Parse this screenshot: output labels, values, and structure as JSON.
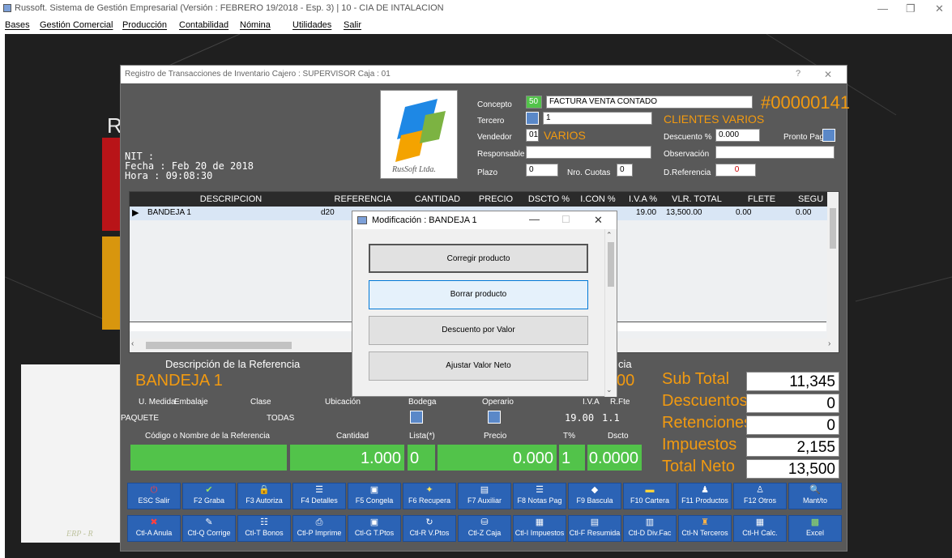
{
  "app": {
    "title": "Russoft. Sistema de Gestión Empresarial (Versión : FEBRERO 19/2018 - Esp. 3) | 10 - CIA DE INTALACION",
    "menu": [
      "Bases",
      "Gestión Comercial",
      "Producción",
      "Contabilidad",
      "Nómina",
      "Utilidades",
      "Salir"
    ],
    "bg_letter": "R",
    "bg_footer": "ERP - R"
  },
  "window": {
    "title": "Registro de Transacciones de Inventario   Cajero : SUPERVISOR  Caja : 01",
    "help": "?",
    "close": "✕",
    "nit_label": "NIT :",
    "fecha": "Fecha : Feb 20 de 2018",
    "hora": "Hora  : 09:08:30",
    "logo_text": "RusSoft Ltda."
  },
  "form": {
    "concepto_label": "Concepto",
    "concepto_code": "50",
    "concepto_value": "FACTURA VENTA CONTADO",
    "doc_number": "#00000141",
    "tercero_label": "Tercero",
    "tercero_value": "1",
    "tercero_name": "CLIENTES VARIOS",
    "vendedor_label": "Vendedor",
    "vendedor_code": "01",
    "vendedor_name": "VARIOS",
    "descuento_label": "Descuento %",
    "descuento_value": "0.000",
    "pronto_pago_label": "Pronto Pago",
    "responsable_label": "Responsable",
    "observacion_label": "Observación",
    "plazo_label": "Plazo",
    "plazo_value": "0",
    "cuotas_label": "Nro. Cuotas",
    "cuotas_value": "0",
    "dref_label": "D.Referencia",
    "dref_value": "0"
  },
  "grid": {
    "headers": [
      "DESCRIPCION",
      "REFERENCIA",
      "CANTIDAD",
      "PRECIO",
      "DSCTO %",
      "I.CON %",
      "I.V.A %",
      "VLR. TOTAL",
      "FLETE",
      "SEGU"
    ],
    "row": {
      "descripcion": "BANDEJA 1",
      "referencia": "d20",
      "iva": "19.00",
      "total": "13,500.00",
      "flete": "0.00",
      "seguro": "0.00"
    }
  },
  "detail": {
    "heading": "Descripción de la Referencia",
    "heading_right": "cia",
    "product_name": "BANDEJA 1",
    "product_right": "00",
    "umedida_label": "U. Medida",
    "umedida_value": "PAQUETE",
    "embalaje_label": "Embalaje",
    "clase_label": "Clase",
    "clase_value": "TODAS",
    "ubicacion_label": "Ubicación",
    "bodega_label": "Bodega",
    "operario_label": "Operario",
    "iva_label": "I.V.A",
    "rfte_label": "R.Fte",
    "iva_value": "19.00",
    "rfte_value": "1.1",
    "codigo_label": "Código o Nombre de la Referencia",
    "cantidad_label": "Cantidad",
    "lista_label": "Lista(*)",
    "precio_label": "Precio",
    "t_label": "T%",
    "dscto_label": "Dscto",
    "cantidad_value": "1.000",
    "lista_value": "0",
    "precio_value": "0.000",
    "t_value": "1",
    "dscto_value": "0.0000"
  },
  "totals": {
    "subtotal_label": "Sub Total",
    "subtotal": "11,345",
    "descuentos_label": "Descuentos",
    "descuentos": "0",
    "retenciones_label": "Retenciones",
    "retenciones": "0",
    "impuestos_label": "Impuestos",
    "impuestos": "2,155",
    "neto_label": "Total Neto",
    "neto": "13,500"
  },
  "fkeys_row1": [
    "ESC Salir",
    "F2 Graba",
    "F3 Autoriza",
    "F4 Detalles",
    "F5 Congela",
    "F6 Recupera",
    "F7 Auxiliar",
    "F8 Notas Pag",
    "F9 Bascula",
    "F10 Cartera",
    "F11 Productos",
    "F12 Otros",
    "Mant/to"
  ],
  "fkeys_row2": [
    "Ctl-A Anula",
    "Ctl-Q Corrige",
    "Ctl-T Bonos",
    "Ctl-P Imprime",
    "Ctl-G T.Ptos",
    "Ctl-R V.Ptos",
    "Ctl-Z Caja",
    "Ctl-I Impuestos",
    "Ctl-F Resumida",
    "Ctl-D Div.Fac",
    "Ctl-N Terceros",
    "Ctl-H Calc.",
    "Excel"
  ],
  "modal": {
    "title": "Modificación : BANDEJA 1",
    "buttons": [
      "Corregir producto",
      "Borrar producto",
      "Descuento por Valor",
      "Ajustar Valor Neto"
    ]
  },
  "colors": {
    "accent_orange": "#f29a10",
    "green": "#52c34a",
    "fkey_blue": "#2b63b5",
    "panel_gray": "#595959"
  }
}
